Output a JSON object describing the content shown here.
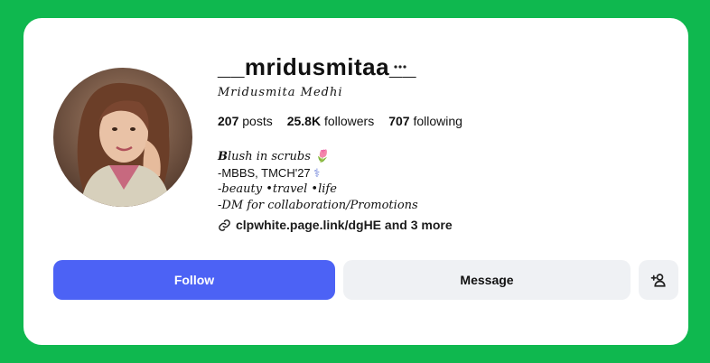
{
  "profile": {
    "username": "__mridusmitaa__",
    "full_name": "𝑀𝑟𝑖𝑑𝑢𝑠𝑚𝑖𝑡𝑎 𝑀𝑒𝑑ℎ𝑖",
    "stats": {
      "posts_count": "207",
      "posts_label": "posts",
      "followers_count": "25.8K",
      "followers_label": "followers",
      "following_count": "707",
      "following_label": "following"
    },
    "bio": {
      "line1_bold": "B",
      "line1_rest": "lush in scrubs",
      "line1_emoji": "🌷",
      "line2": "-MBBS, TMCH'27",
      "line2_emoji": "⚕",
      "line3": "-beauty •travel •life",
      "line4": "-DM for collaboration/Promotions"
    },
    "link": "clpwhite.page.link/dgHE and 3 more"
  },
  "actions": {
    "follow_label": "Follow",
    "message_label": "Message"
  },
  "icons": {
    "more": "more-horizontal-icon",
    "link": "link-chain-icon",
    "add_user": "add-user-icon"
  },
  "colors": {
    "background": "#0fb84f",
    "follow_button": "#4c62f5",
    "secondary_button": "#eff1f4"
  }
}
